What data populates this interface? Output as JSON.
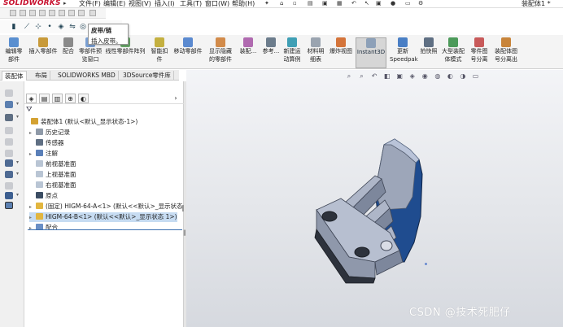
{
  "app": {
    "brand": "SOLIDWORKS",
    "menus": [
      "文件(F)",
      "编辑(E)",
      "视图(V)",
      "插入(I)",
      "工具(T)",
      "窗口(W)",
      "帮助(H)"
    ],
    "document_title": "装配体1 *"
  },
  "tooltip": {
    "title": "皮带/链",
    "description": "插入皮带。"
  },
  "ribbon": {
    "buttons": [
      {
        "label1": "编辑零",
        "label2": "部件",
        "color": "#5a8fd0"
      },
      {
        "label1": "插入零部件",
        "label2": "",
        "color": "#c89a3a"
      },
      {
        "label1": "配合",
        "label2": "",
        "color": "#8a8a8a"
      },
      {
        "label1": "零部件预",
        "label2": "览窗口",
        "color": "#7a9fd2"
      },
      {
        "label1": "线性零部件阵列",
        "label2": "",
        "color": "#6aa86a"
      },
      {
        "label1": "智能扣",
        "label2": "件",
        "color": "#c4b040"
      },
      {
        "label1": "移动零部件",
        "label2": "",
        "color": "#5b8ad0"
      },
      {
        "label1": "显示隐藏",
        "label2": "的零部件",
        "color": "#d28b4a"
      },
      {
        "label1": "装配...",
        "label2": "",
        "color": "#b06ab0"
      },
      {
        "label1": "参考...",
        "label2": "",
        "color": "#6c7c8c"
      },
      {
        "label1": "新建运",
        "label2": "动算例",
        "color": "#3f9fb5"
      },
      {
        "label1": "材料明",
        "label2": "细表",
        "color": "#9aa4b0"
      },
      {
        "label1": "爆炸视图",
        "label2": "",
        "color": "#d4743a"
      },
      {
        "label1": "Instant3D",
        "label2": "",
        "color": "#8da0b8"
      },
      {
        "label1": "更新",
        "label2": "Speedpak",
        "color": "#4a7fc5"
      },
      {
        "label1": "拍快照",
        "label2": "",
        "color": "#5f6f83"
      },
      {
        "label1": "大型装配",
        "label2": "体模式",
        "color": "#4c9a5a"
      },
      {
        "label1": "零件图",
        "label2": "号分离",
        "color": "#c85a5a"
      },
      {
        "label1": "装配体图",
        "label2": "号分离出",
        "color": "#c8843a"
      }
    ]
  },
  "tabs": [
    "装配体",
    "布局",
    "SOLIDWORKS MBD",
    "3DSource零件库"
  ],
  "tree": [
    {
      "text": "装配体1 (默认<默认_显示状态-1>)",
      "color": "#d4a233",
      "twisty": ""
    },
    {
      "text": "历史记录",
      "color": "#8f9aa8",
      "twisty": "▸"
    },
    {
      "text": "传感器",
      "color": "#5f6f83",
      "twisty": ""
    },
    {
      "text": "注解",
      "color": "#5a7fb8",
      "twisty": "▸"
    },
    {
      "text": "前视基准面",
      "color": "#b9c5d4",
      "twisty": ""
    },
    {
      "text": "上视基准面",
      "color": "#b9c5d4",
      "twisty": ""
    },
    {
      "text": "右视基准面",
      "color": "#b9c5d4",
      "twisty": ""
    },
    {
      "text": "原点",
      "color": "#3b4d63",
      "twisty": ""
    },
    {
      "text": "(固定) HIGM-64-A<1> (默认<<默认>_显示状态",
      "color": "#e2b640",
      "twisty": "▸"
    },
    {
      "text": "HIGM-64-B<1> (默认<<默认>_显示状态 1>)",
      "color": "#e2b640",
      "twisty": "▸"
    },
    {
      "text": "配合",
      "color": "#6a8fc5",
      "twisty": "▸"
    }
  ],
  "watermark": "CSDN @技术死肥仔",
  "colors": {
    "part_blue": "#1f4c8f",
    "part_gray": "#9da6b9",
    "selection": "#c7dcf2"
  }
}
